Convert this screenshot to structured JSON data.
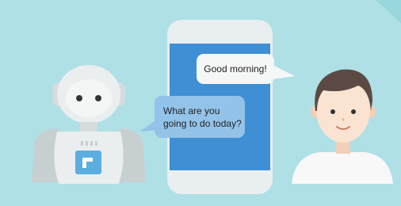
{
  "messages": {
    "user": {
      "text": "Good morning!"
    },
    "robot": {
      "line1": "What are you",
      "line2": "going to do today?"
    }
  },
  "colors": {
    "background_panel": "#aee0e6",
    "phone_frame": "#e9eef0",
    "phone_screen": "#3f8fd4",
    "user_bubble": "#f5f6f6",
    "robot_bubble": "#93c3e9",
    "robot_body": "#ebeeee",
    "robot_chest_screen": "#5aaee0",
    "person_hair": "#5b4a44",
    "person_skin": "#fae3d1",
    "person_shirt": "#f8f8f8"
  }
}
